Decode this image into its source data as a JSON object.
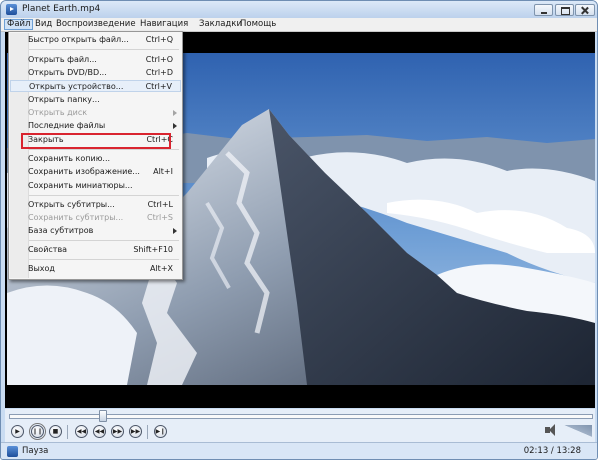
{
  "window": {
    "title": "Planet Earth.mp4"
  },
  "menubar": {
    "items": [
      "Файл",
      "Вид",
      "Воспроизведение",
      "Навигация",
      "Закладки",
      "Помощь"
    ],
    "active_index": 0
  },
  "file_menu": {
    "items": [
      {
        "label": "Быстро открыть файл...",
        "shortcut": "Ctrl+Q",
        "enabled": true
      },
      {
        "label": "Открыть файл...",
        "shortcut": "Ctrl+O",
        "enabled": true
      },
      {
        "label": "Открыть DVD/BD...",
        "shortcut": "Ctrl+D",
        "enabled": true
      },
      {
        "label": "Открыть устройство...",
        "shortcut": "Ctrl+V",
        "enabled": true
      },
      {
        "label": "Открыть папку...",
        "shortcut": "",
        "enabled": true
      },
      {
        "label": "Открыть диск",
        "shortcut": "",
        "enabled": false,
        "submenu": true
      },
      {
        "label": "Последние файлы",
        "shortcut": "",
        "enabled": true,
        "submenu": true
      },
      {
        "label": "Закрыть",
        "shortcut": "Ctrl+C",
        "enabled": true
      },
      {
        "label": "Сохранить копию...",
        "shortcut": "",
        "enabled": true
      },
      {
        "label": "Сохранить изображение...",
        "shortcut": "Alt+I",
        "enabled": true,
        "highlighted": true
      },
      {
        "label": "Сохранить миниатюры...",
        "shortcut": "",
        "enabled": true
      },
      {
        "label": "Открыть субтитры...",
        "shortcut": "Ctrl+L",
        "enabled": true
      },
      {
        "label": "Сохранить субтитры...",
        "shortcut": "Ctrl+S",
        "enabled": false
      },
      {
        "label": "База субтитров",
        "shortcut": "",
        "enabled": true,
        "submenu": true
      },
      {
        "label": "Свойства",
        "shortcut": "Shift+F10",
        "enabled": true
      },
      {
        "label": "Выход",
        "shortcut": "Alt+X",
        "enabled": true
      }
    ]
  },
  "controls": {
    "buttons": [
      "play-icon",
      "pause-icon",
      "stop-icon",
      "skip-back-icon",
      "rewind-icon",
      "fast-forward-icon",
      "skip-forward-icon",
      "frame-step-icon"
    ]
  },
  "seek": {
    "position_fraction": 0.16
  },
  "status": {
    "state": "Пауза",
    "time": "02:13 / 13:28"
  },
  "colors": {
    "highlight_border": "#d9242f",
    "chrome": "#c9dcf2",
    "menu_bg": "#f5f5f5"
  }
}
